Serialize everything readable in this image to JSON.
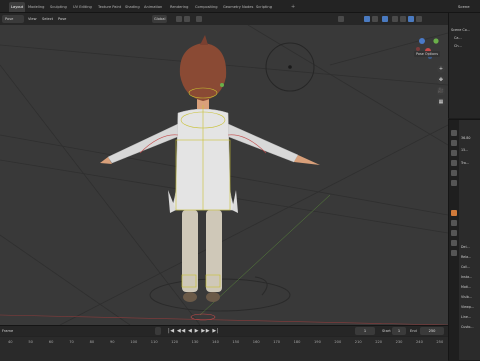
{
  "workspace_tabs": [
    "Layout",
    "Modeling",
    "Sculpting",
    "UV Editing",
    "Texture Paint",
    "Shading",
    "Animation",
    "Rendering",
    "Compositing",
    "Geometry Nodes",
    "Scripting"
  ],
  "workspace_add": "+",
  "scene_name": "Scene",
  "viewport": {
    "mode_label": "Pose",
    "menu": [
      "View",
      "Select",
      "Pose"
    ],
    "transform_label": "Global",
    "pose_options_label": "Pose Options"
  },
  "navigation": {
    "zoom": "+",
    "pan": "✥",
    "camera": "🎥",
    "ortho": "▦"
  },
  "outliner": {
    "rows": [
      "Scene Co...",
      "Ca...",
      "Ch..."
    ]
  },
  "properties": {
    "rows": [
      "36.80",
      "15...",
      "Tra...",
      "Del...",
      "Rela...",
      "Coll...",
      "Insta...",
      "Moti...",
      "Visib...",
      "Viewp...",
      "Line...",
      "Custo..."
    ]
  },
  "timeline": {
    "current_frame_label": "Frame",
    "current_frame": "1",
    "start_label": "Start",
    "start": "1",
    "end_label": "End",
    "end": "250",
    "playback_controls": "|◀ ◀◀ ◀ ▶ ▶▶ ▶|",
    "ticks": [
      "40",
      "50",
      "60",
      "70",
      "80",
      "90",
      "100",
      "110",
      "120",
      "130",
      "140",
      "150",
      "160",
      "170",
      "180",
      "190",
      "200",
      "210",
      "220",
      "230",
      "240",
      "250"
    ]
  },
  "colors": {
    "active_tab": "#3d3d3d",
    "accent_orange": "#d07a3a",
    "selection_blue": "#4a7ac0",
    "viewport_bg": "#393939"
  }
}
